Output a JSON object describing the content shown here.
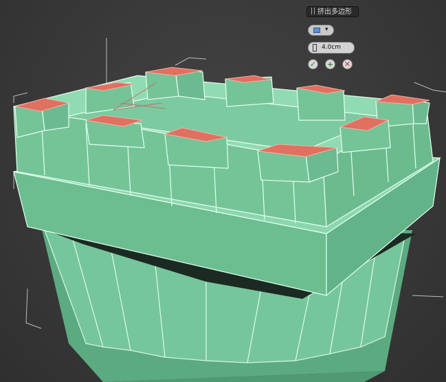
{
  "caddy": {
    "title": "挤出多边形",
    "mode_icon": "group-mode-icon",
    "height_value": "4.0cm",
    "ok_icon": "checkmark-icon",
    "apply_icon": "plus-icon",
    "cancel_icon": "x-icon"
  },
  "colors": {
    "background": "#3a3a3a",
    "model_face": "#6fbf92",
    "selected_face": "#e07060",
    "wire": "#e6fff0"
  }
}
